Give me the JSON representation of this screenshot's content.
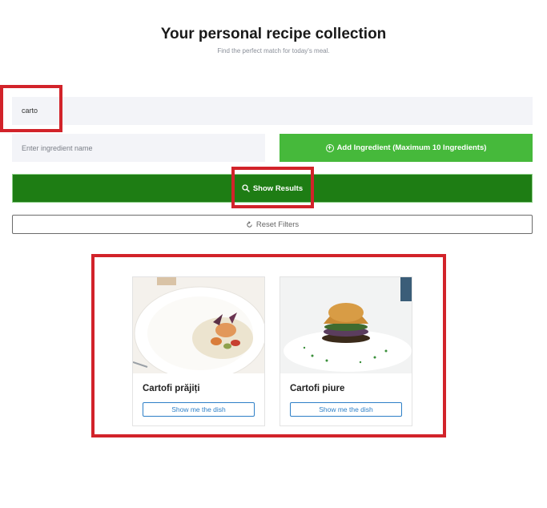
{
  "header": {
    "title": "Your personal recipe collection",
    "subtitle": "Find the perfect match for today's meal."
  },
  "search": {
    "value": "carto"
  },
  "ingredient": {
    "placeholder": "Enter ingredient name",
    "add_label": "Add Ingredient (Maximum 10 Ingredients)"
  },
  "actions": {
    "show_results_label": "Show Results",
    "reset_label": "Reset Filters"
  },
  "results": [
    {
      "title": "Cartofi prăjiți",
      "button_label": "Show me the dish"
    },
    {
      "title": "Cartofi piure",
      "button_label": "Show me the dish"
    }
  ],
  "colors": {
    "add_button": "#46b93b",
    "show_results": "#1e7d14",
    "link_blue": "#2d7fc7",
    "highlight": "#d2232a"
  }
}
